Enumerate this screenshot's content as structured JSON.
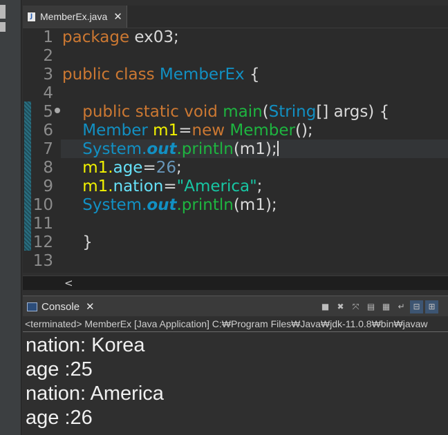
{
  "editor": {
    "tab_title": "MemberEx.java",
    "tab_close": "✕",
    "line_numbers": [
      "1",
      "2",
      "3",
      "4",
      "5",
      "6",
      "7",
      "8",
      "9",
      "10",
      "11",
      "12",
      "13"
    ],
    "code": {
      "l1_kw": "package",
      "l1_rest": " ex03;",
      "l3_kw": "public class",
      "l3_cls": "MemberEx",
      "l3_rest": " {",
      "l5_kw": "public static void",
      "l5_mth": "main",
      "l5_open": "(",
      "l5_cls": "String",
      "l5_rest": "[] args) {",
      "l6_cls": "Member",
      "l6_var": "m1",
      "l6_eq": "=",
      "l6_kw": "new",
      "l6_mth": "Member",
      "l6_rest": "();",
      "l7_cls": "System.",
      "l7_out": "out",
      "l7_mth": ".println",
      "l7_rest": "(m1);",
      "l8_a": "m1.",
      "l8_fld": "age",
      "l8_eq": "=",
      "l8_num": "26",
      "l8_rest": ";",
      "l9_a": "m1.",
      "l9_fld": "nation",
      "l9_eq": "=",
      "l9_str": "\"America\"",
      "l9_rest": ";",
      "l10_cls": "System.",
      "l10_out": "out",
      "l10_mth": ".println",
      "l10_rest": "(m1);",
      "l12": "}"
    },
    "scroll_left": "<"
  },
  "console": {
    "tab_title": "Console",
    "tab_close": "✕",
    "status": "<terminated> MemberEx [Java Application] C:₩Program Files₩Java₩jdk-11.0.8₩bin₩javaw",
    "output": [
      "nation: Korea",
      "age :25",
      "nation: America",
      "age :26"
    ]
  },
  "toolbar_icons": [
    "stop-icon",
    "remove-launch-icon",
    "remove-all-icon",
    "clear-console-icon",
    "scroll-lock-icon",
    "word-wrap-icon",
    "pin-console-icon",
    "display-console-icon"
  ]
}
